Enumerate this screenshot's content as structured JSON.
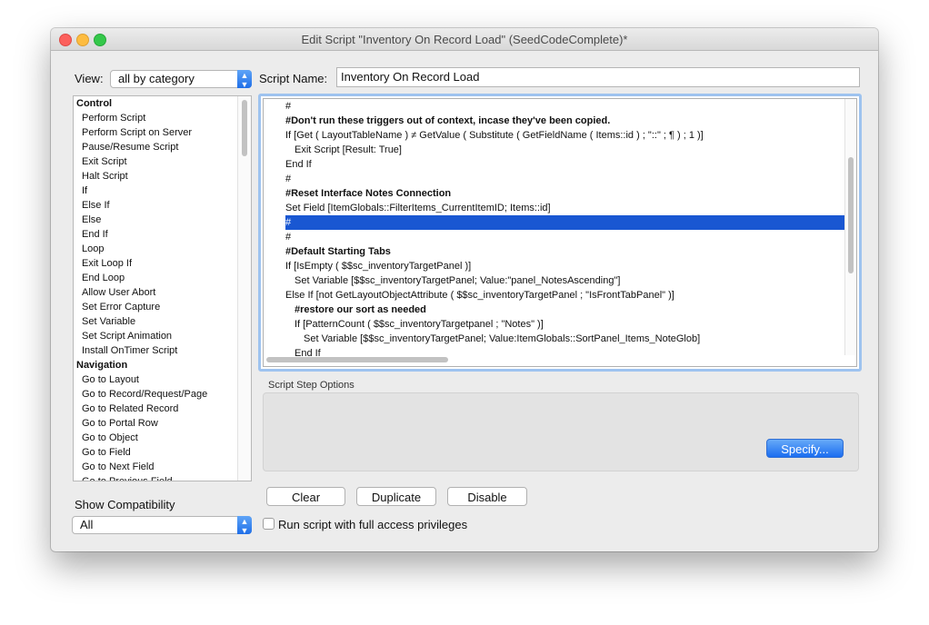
{
  "window": {
    "title": "Edit Script \"Inventory On Record Load\" (SeedCodeComplete)*"
  },
  "view": {
    "label": "View:",
    "selected": "all by category"
  },
  "script_name": {
    "label": "Script Name:",
    "value": "Inventory On Record Load"
  },
  "commands": [
    {
      "label": "Control",
      "category": true
    },
    {
      "label": "Perform Script"
    },
    {
      "label": "Perform Script on Server"
    },
    {
      "label": "Pause/Resume Script"
    },
    {
      "label": "Exit Script"
    },
    {
      "label": "Halt Script"
    },
    {
      "label": "If"
    },
    {
      "label": "Else If"
    },
    {
      "label": "Else"
    },
    {
      "label": "End If"
    },
    {
      "label": "Loop"
    },
    {
      "label": "Exit Loop If"
    },
    {
      "label": "End Loop"
    },
    {
      "label": "Allow User Abort"
    },
    {
      "label": "Set Error Capture"
    },
    {
      "label": "Set Variable"
    },
    {
      "label": "Set Script Animation"
    },
    {
      "label": "Install OnTimer Script"
    },
    {
      "label": "Navigation",
      "category": true
    },
    {
      "label": "Go to Layout"
    },
    {
      "label": "Go to Record/Request/Page"
    },
    {
      "label": "Go to Related Record"
    },
    {
      "label": "Go to Portal Row"
    },
    {
      "label": "Go to Object"
    },
    {
      "label": "Go to Field"
    },
    {
      "label": "Go to Next Field"
    },
    {
      "label": "Go to Previous Field"
    }
  ],
  "script_lines": [
    {
      "text": "#",
      "indent": 0,
      "bold": false
    },
    {
      "text": "#Don't run these triggers out of context, incase they've been copied.",
      "indent": 0,
      "bold": true
    },
    {
      "text": "If [Get ( LayoutTableName )  ≠ GetValue ( Substitute ( GetFieldName ( Items::id ) ; \"::\" ; ¶ ) ; 1 )]",
      "indent": 0,
      "bold": false
    },
    {
      "text": "Exit Script [Result: True]",
      "indent": 1,
      "bold": false
    },
    {
      "text": "End If",
      "indent": 0,
      "bold": false
    },
    {
      "text": "#",
      "indent": 0,
      "bold": false
    },
    {
      "text": "#Reset Interface Notes Connection",
      "indent": 0,
      "bold": true
    },
    {
      "text": "Set Field [ItemGlobals::FilterItems_CurrentItemID; Items::id]",
      "indent": 0,
      "bold": false
    },
    {
      "text": "#",
      "indent": 0,
      "bold": false,
      "selected": true
    },
    {
      "text": "#",
      "indent": 0,
      "bold": false
    },
    {
      "text": "#Default Starting Tabs",
      "indent": 0,
      "bold": true
    },
    {
      "text": "If [IsEmpty ( $$sc_inventoryTargetPanel )]",
      "indent": 0,
      "bold": false
    },
    {
      "text": "Set Variable [$$sc_inventoryTargetPanel; Value:\"panel_NotesAscending\"]",
      "indent": 1,
      "bold": false
    },
    {
      "text": "Else If [not GetLayoutObjectAttribute ( $$sc_inventoryTargetPanel ; \"IsFrontTabPanel\" )]",
      "indent": 0,
      "bold": false
    },
    {
      "text": "#restore our sort as needed",
      "indent": 1,
      "bold": true
    },
    {
      "text": "If [PatternCount ( $$sc_inventoryTargetpanel ; \"Notes\" )]",
      "indent": 1,
      "bold": false
    },
    {
      "text": "Set Variable [$$sc_inventoryTargetPanel; Value:ItemGlobals::SortPanel_Items_NoteGlob]",
      "indent": 2,
      "bold": false
    },
    {
      "text": "End If",
      "indent": 1,
      "bold": false
    }
  ],
  "options": {
    "label": "Script Step Options",
    "specify_label": "Specify..."
  },
  "buttons": {
    "clear": "Clear",
    "duplicate": "Duplicate",
    "disable": "Disable"
  },
  "compatibility": {
    "label": "Show Compatibility",
    "selected": "All"
  },
  "full_access": {
    "label": "Run script with full access privileges",
    "checked": false
  },
  "colors": {
    "selection": "#1957d2",
    "accent": "#1b6df0",
    "close": "#fc605c",
    "minimize": "#fdbc40",
    "maximize": "#34c84a"
  }
}
